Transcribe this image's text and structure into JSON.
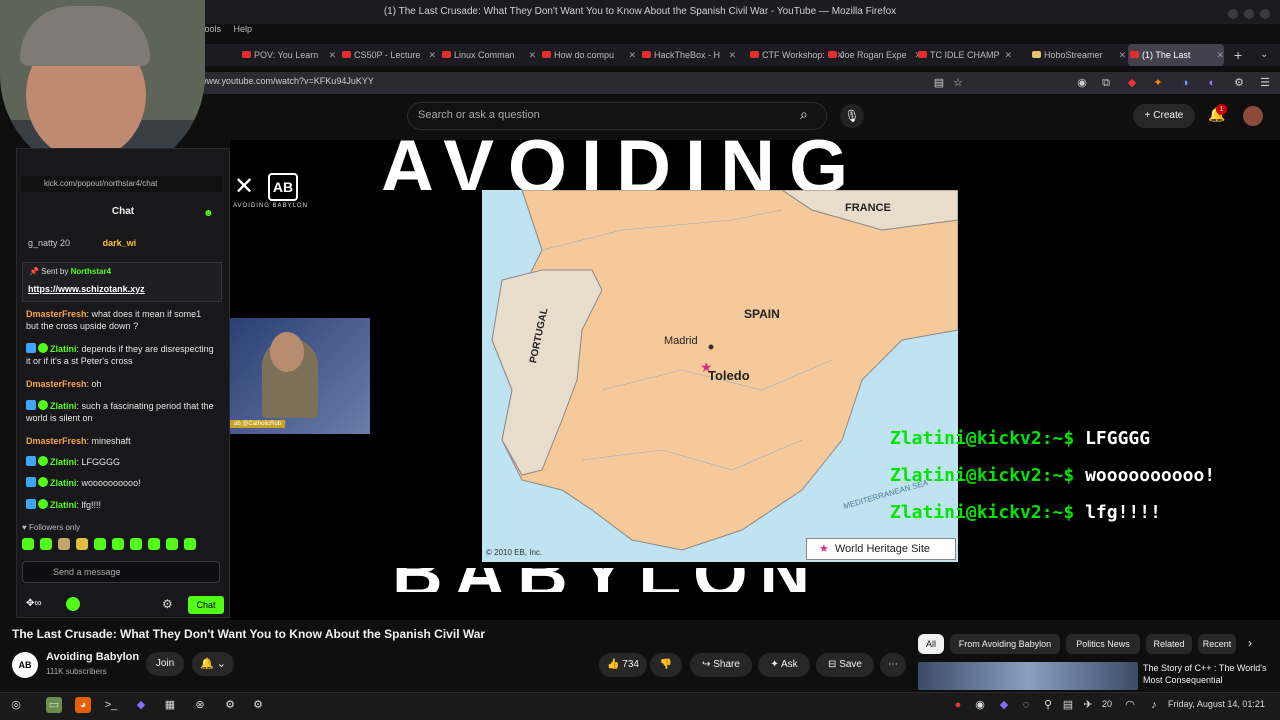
{
  "window": {
    "title": "(1) The Last Crusade: What They Don't Want You to Know About the Spanish Civil War - YouTube — Mozilla Firefox",
    "menu": [
      "Tools",
      "Help"
    ]
  },
  "tabs": [
    {
      "label": "POV: You Learn"
    },
    {
      "label": "CS50P - Lecture"
    },
    {
      "label": "Linux Comman"
    },
    {
      "label": "How do compu"
    },
    {
      "label": "HackTheBox - H"
    },
    {
      "label": "CTF Workshop:"
    },
    {
      "label": "Joe Rogan Expe"
    },
    {
      "label": "TC IDLE CHAMP"
    },
    {
      "label": "HoboStreamer"
    },
    {
      "label": "(1) The Last"
    }
  ],
  "url": "www.youtube.com/watch?v=KFKu94JuKYY",
  "youtube": {
    "search_placeholder": "Search or ask a question",
    "create_label": "Create",
    "notif_count": "1"
  },
  "video": {
    "big_text_top": "AVOIDING",
    "big_text_bottom": "BABYLON",
    "logo_ab": "AB",
    "logo_name": "AVOIDING BABYLON",
    "webcam_label": "ab @CatholicRob",
    "map": {
      "labels": {
        "france": "FRANCE",
        "spain": "SPAIN",
        "portugal": "PORTUGAL",
        "madrid": "Madrid",
        "toledo": "Toledo",
        "sea": "MEDITERRANEAN SEA"
      },
      "legend": "World Heritage Site",
      "copyright": "© 2010 EB, Inc."
    },
    "terminal": [
      {
        "user": "Zlatini@kickv2:~$",
        "msg": "LFGGGG"
      },
      {
        "user": "Zlatini@kickv2:~$",
        "msg": "woooooooooo!"
      },
      {
        "user": "Zlatini@kickv2:~$",
        "msg": "lfg!!!!"
      }
    ]
  },
  "chat": {
    "url": "kick.com/popout/northstar4/chat",
    "header": "Chat",
    "top_user": "g_natty",
    "top_count": "20",
    "top_user2": "dark_wi",
    "pinned_by_label": "Sent by",
    "pinned_by_user": "Northstar4",
    "pinned_link": "https://www.schizotank.xyz",
    "messages": [
      {
        "user": "DmasterFresh",
        "text": "what does it mean if some1 but the cross upside down ?",
        "color": "orange"
      },
      {
        "user": "Zlatini",
        "text": "depends if they are disrespecting it or if it's a st Peter's cross",
        "color": "green"
      },
      {
        "user": "DmasterFresh",
        "text": "oh",
        "color": "orange"
      },
      {
        "user": "Zlatini",
        "text": "such a fascinating period that the world is silent on",
        "color": "green"
      },
      {
        "user": "DmasterFresh",
        "text": "mineshaft",
        "color": "orange"
      },
      {
        "user": "Zlatini",
        "text": "LFGGGG",
        "color": "green"
      },
      {
        "user": "Zlatini",
        "text": "woooooooooo!",
        "color": "green"
      },
      {
        "user": "Zlatini",
        "text": "lfg!!!!",
        "color": "green"
      }
    ],
    "followers_only": "Followers only",
    "input_placeholder": "Send a message",
    "send_label": "Chat"
  },
  "watch": {
    "title": "The Last Crusade: What They Don't Want You to Know About the Spanish Civil War",
    "channel": "Avoiding Babylon",
    "subs": "111K subscribers",
    "join": "Join",
    "likes": "734",
    "share": "Share",
    "ask": "Ask",
    "save": "Save"
  },
  "chips": [
    "All",
    "From Avoiding Babylon",
    "Politics News",
    "Related",
    "Recent"
  ],
  "related": {
    "title": "The Story of C++ : The World's Most Consequential"
  },
  "taskbar": {
    "temp": "20",
    "clock": "Friday, August 14, 01:21"
  }
}
